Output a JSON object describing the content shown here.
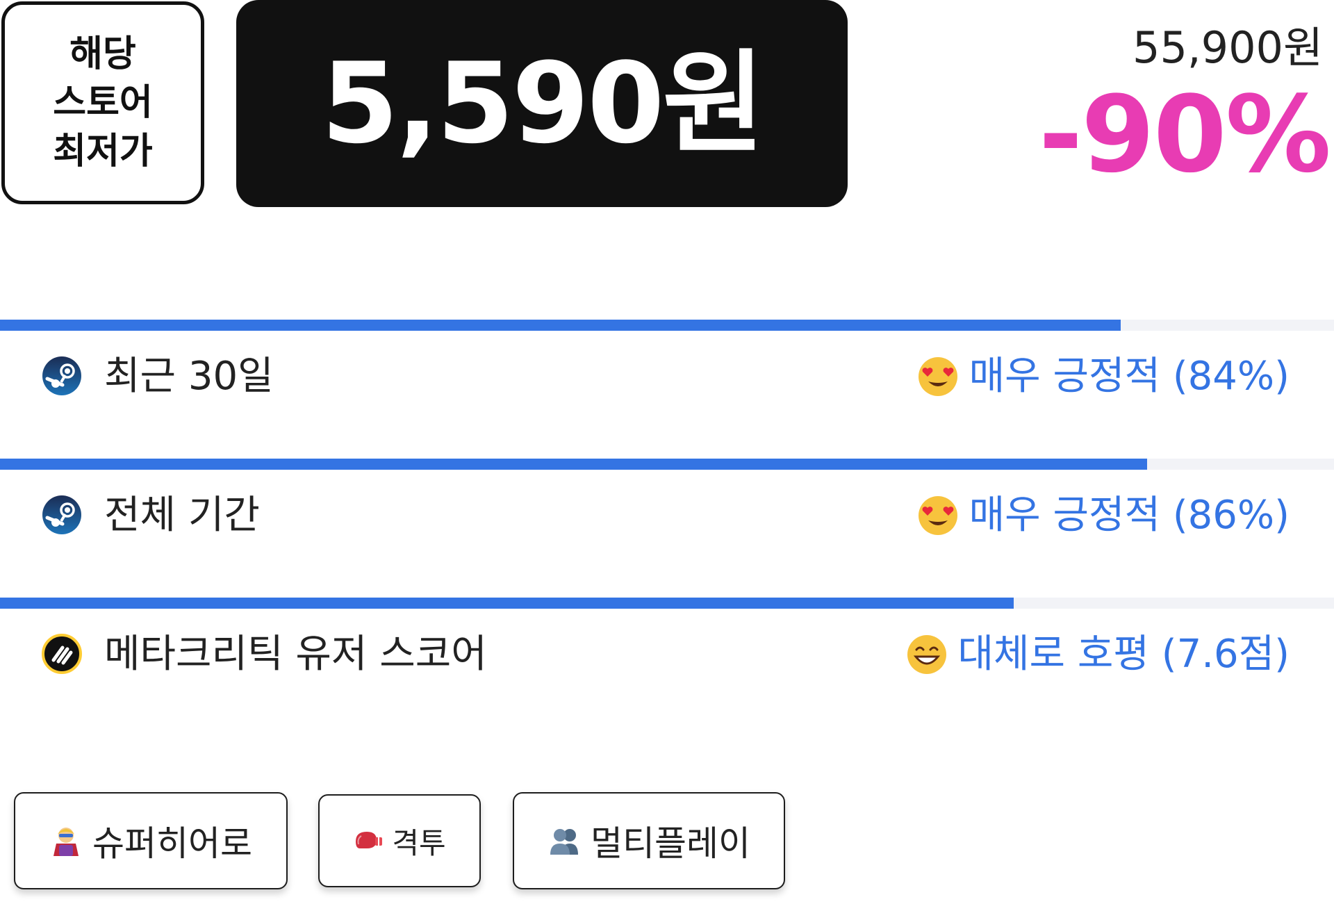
{
  "price": {
    "lowest_label_lines": [
      "해당",
      "스토어",
      "최저가"
    ],
    "sale_price": "5,590원",
    "original_price": "55,900원",
    "discount": "-90%"
  },
  "colors": {
    "accent_blue": "#3474e3",
    "discount_pink": "#e83cb3",
    "dark_box": "#111111",
    "track": "#f2f3f7"
  },
  "reviews": [
    {
      "source_icon": "steam-icon",
      "label": "최근 30일",
      "emoji": "heart-eyes-emoji",
      "rating": "매우 긍정적 (84%)",
      "bar_percent": 84
    },
    {
      "source_icon": "steam-icon",
      "label": "전체 기간",
      "emoji": "heart-eyes-emoji",
      "rating": "매우 긍정적 (86%)",
      "bar_percent": 86
    },
    {
      "source_icon": "metacritic-icon",
      "label": "메타크리틱 유저 스코어",
      "emoji": "grinning-emoji",
      "rating": "대체로 호평 (7.6점)",
      "bar_percent": 76
    }
  ],
  "tags": [
    {
      "icon": "superhero-icon",
      "label": "슈퍼히어로"
    },
    {
      "icon": "boxing-glove-icon",
      "label": "격투"
    },
    {
      "icon": "people-icon",
      "label": "멀티플레이"
    }
  ]
}
